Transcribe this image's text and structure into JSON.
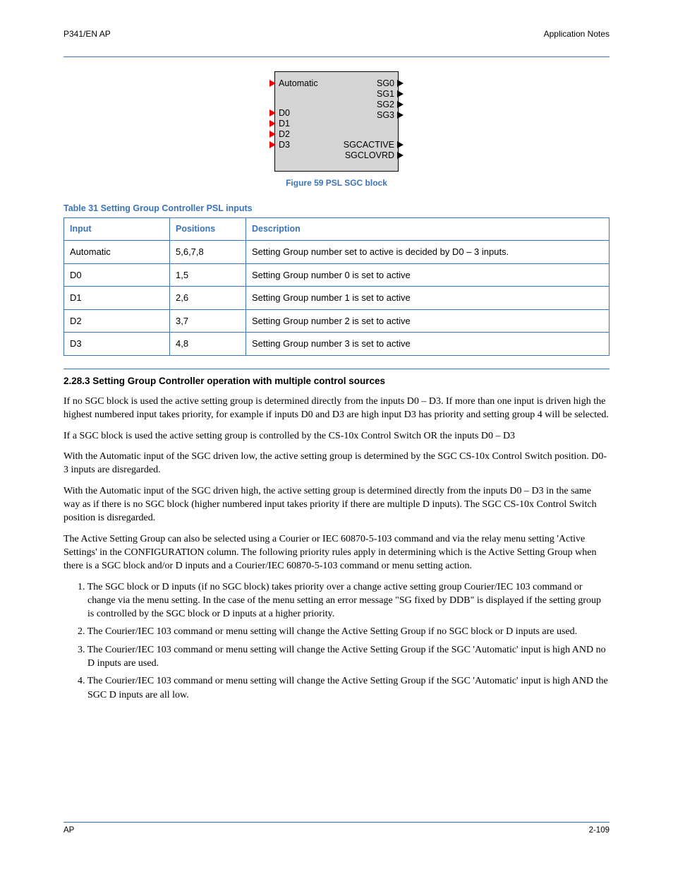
{
  "header": {
    "left": "P341/EN AP",
    "right": "Application Notes"
  },
  "diagram": {
    "inputs": {
      "auto": "Automatic",
      "d0": "D0",
      "d1": "D1",
      "d2": "D2",
      "d3": "D3"
    },
    "outputs": {
      "sg0": "SG0",
      "sg1": "SG1",
      "sg2": "SG2",
      "sg3": "SG3",
      "active": "SGCACTIVE",
      "ovrd": "SGCLOVRD"
    }
  },
  "figure_caption": "Figure 59 PSL SGC block",
  "table_caption": "Table 31 Setting Group Controller PSL inputs",
  "table_head": {
    "input": "Input",
    "pos": "Positions",
    "desc": "Description"
  },
  "table_rows": [
    {
      "input": "Automatic",
      "pos": "5,6,7,8",
      "desc": "Setting Group number set to active is decided by D0 – 3 inputs."
    },
    {
      "input": "D0",
      "pos": "1,5",
      "desc": "Setting Group number 0 is set to active"
    },
    {
      "input": "D1",
      "pos": "2,6",
      "desc": "Setting Group number 1 is set to active"
    },
    {
      "input": "D2",
      "pos": "3,7",
      "desc": "Setting Group number 2 is set to active"
    },
    {
      "input": "D3",
      "pos": "4,8",
      "desc": "Setting Group number 3 is set to active"
    }
  ],
  "section_title": "2.28.3 Setting Group Controller operation with multiple control sources",
  "paragraphs": {
    "p1": "If no SGC block is used the active setting group is determined directly from the inputs D0 – D3. If more than one input is driven high the highest numbered input takes priority, for example if inputs D0 and D3 are high input D3 has priority and setting group 4 will be selected.",
    "p2": "If a SGC block is used the active setting group is controlled by the CS-10x Control Switch OR the inputs D0 – D3",
    "p3": "With the Automatic input of the SGC driven low, the active setting group is determined by the SGC CS-10x Control Switch position. D0-3 inputs are disregarded.",
    "p4": "With the Automatic input of the SGC driven high, the active setting group is determined directly from the inputs D0 – D3 in the same way as if there is no SGC block (higher numbered input takes priority if there are multiple D inputs). The SGC CS-10x Control Switch position is disregarded.",
    "p5": "The Active Setting Group can also be selected using a Courier or IEC 60870-5-103 command and via the relay menu setting 'Active Settings' in the CONFIGURATION column. The following priority rules apply in determining which is the Active Setting Group when there is a SGC block and/or D inputs and a Courier/IEC 60870-5-103 command or menu setting action.",
    "l1": "1. The SGC block or D inputs (if no SGC block) takes priority over a change active setting group Courier/IEC 103 command or change via the menu setting. In the case of the menu setting an error message \"SG fixed by DDB\" is displayed if the setting group is controlled by the SGC block or D inputs at a higher priority.",
    "l2": "2. The Courier/IEC 103 command or menu setting will change the Active Setting Group if no SGC block or D inputs are used.",
    "l3": "3. The Courier/IEC 103 command or menu setting will change the Active Setting Group if the SGC 'Automatic' input is high AND no D inputs are used.",
    "l4": "4. The Courier/IEC 103 command or menu setting will change the Active Setting Group if the SGC 'Automatic' input is high AND the SGC D inputs are all low."
  },
  "footer": {
    "left": "AP",
    "right": "2-109"
  }
}
